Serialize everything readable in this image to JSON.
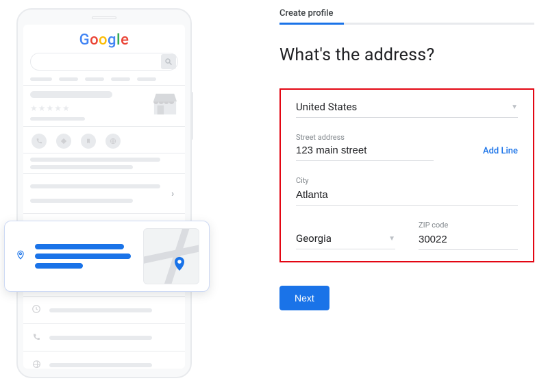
{
  "left": {
    "logo_chars": [
      "G",
      "o",
      "o",
      "g",
      "l",
      "e"
    ],
    "stars": "★★★★★"
  },
  "step_title": "Create profile",
  "heading": "What's the address?",
  "country": {
    "value": "United States"
  },
  "street": {
    "label": "Street address",
    "value": "123 main street",
    "add_line": "Add Line"
  },
  "city": {
    "label": "City",
    "value": "Atlanta"
  },
  "state": {
    "value": "Georgia"
  },
  "zip": {
    "label": "ZIP code",
    "value": "30022"
  },
  "next": "Next"
}
